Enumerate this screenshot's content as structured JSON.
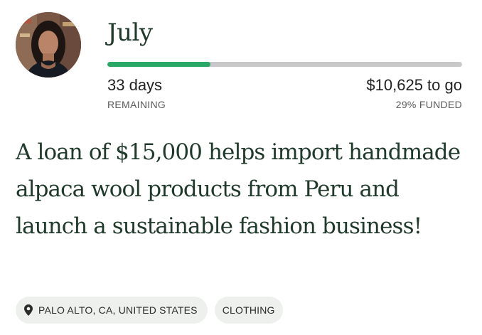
{
  "borrower": {
    "name": "July"
  },
  "funding": {
    "progress_percent": 29,
    "days_value": "33 days",
    "days_caption": "REMAINING",
    "to_go_value": "$10,625 to go",
    "funded_caption": "29% FUNDED"
  },
  "loan": {
    "description": "A loan of $15,000 helps import handmade alpaca wool products from Peru and launch a sustainable fashion business!"
  },
  "tags": {
    "location": "PALO ALTO, CA, UNITED STATES",
    "location_icon": "map-pin-icon",
    "category": "CLOTHING"
  },
  "colors": {
    "progress_fill": "#2aa866",
    "progress_track": "#c9c9c9",
    "heading_text": "#1f3a2b",
    "tag_background": "#eef0ee"
  }
}
